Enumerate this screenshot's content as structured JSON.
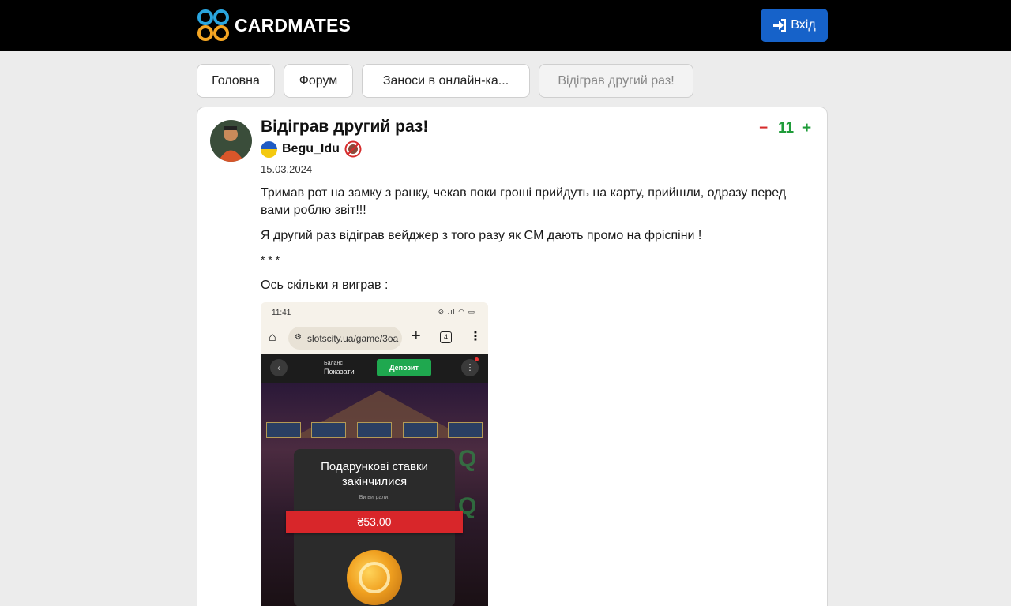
{
  "header": {
    "logo_text": "CARDMATES",
    "login_label": "Вхід"
  },
  "breadcrumbs": [
    {
      "label": "Головна",
      "active": false
    },
    {
      "label": "Форум",
      "active": false
    },
    {
      "label": "Заноси в онлайн-ка...",
      "active": false
    },
    {
      "label": "Відіграв другий раз!",
      "active": true
    }
  ],
  "post": {
    "title": "Відіграв другий раз!",
    "author": "Begu_Idu",
    "date": "15.03.2024",
    "votes": {
      "minus": "−",
      "count": "11",
      "plus": "+"
    },
    "paragraphs": [
      "Тримав рот на замку з ранку, чекав поки гроші прийдуть на карту, прийшли, одразу перед вами роблю звіт!!!",
      "Я другий раз відіграв вейджер з того разу як CM дають промо на фріспіни !",
      "* * *",
      "Ось скільки я виграв :"
    ]
  },
  "screenshot": {
    "time": "11:41",
    "url": "slotscity.ua/game/3oa",
    "tabs_count": "4",
    "balance_label": "Баланс",
    "balance_value": "Показати",
    "deposit_label": "Депозит",
    "popup_title_1": "Подарункові ставки",
    "popup_title_2": "закінчилися",
    "popup_sub": "Ви виграли:",
    "win_amount": "₴53.00"
  },
  "colors": {
    "header_bg": "#000000",
    "login_button": "#1662c9",
    "vote_minus": "#d62b2b",
    "vote_plus": "#1f9c3a"
  }
}
